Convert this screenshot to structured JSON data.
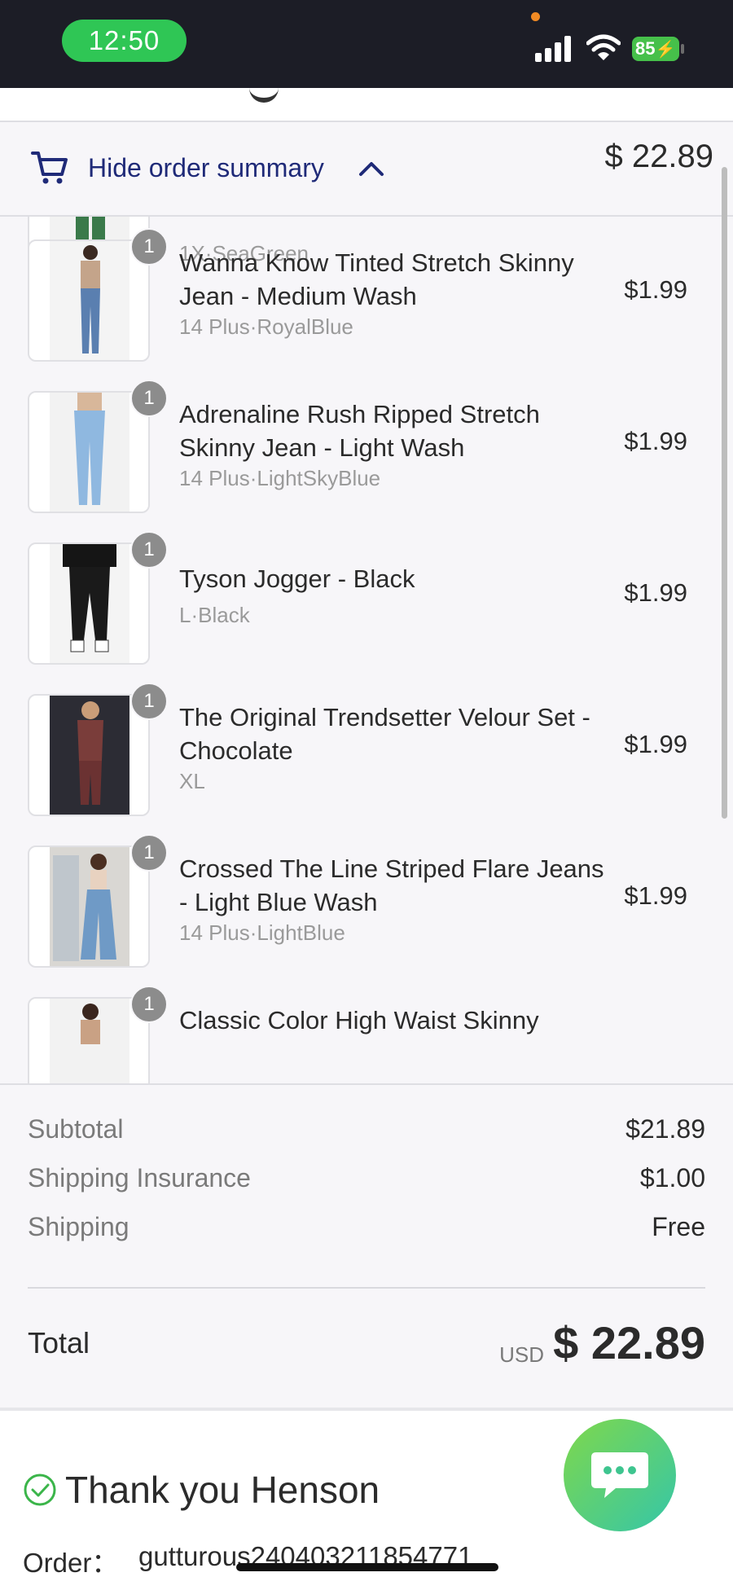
{
  "status_bar": {
    "time": "12:50",
    "battery": "85"
  },
  "summary": {
    "toggle_label": "Hide order summary",
    "header_total": "$ 22.89"
  },
  "items": [
    {
      "name": "",
      "variant": "1X·SeaGreen",
      "price": "",
      "qty": ""
    },
    {
      "name": "Wanna Know Tinted Stretch Skinny Jean - Medium Wash",
      "variant": "14 Plus·RoyalBlue",
      "price": "$1.99",
      "qty": "1"
    },
    {
      "name": "Adrenaline Rush Ripped Stretch Skinny Jean - Light Wash",
      "variant": "14 Plus·LightSkyBlue",
      "price": "$1.99",
      "qty": "1"
    },
    {
      "name": "Tyson Jogger - Black",
      "variant": "L·Black",
      "price": "$1.99",
      "qty": "1"
    },
    {
      "name": "The Original Trendsetter Velour Set - Chocolate",
      "variant": "XL",
      "price": "$1.99",
      "qty": "1"
    },
    {
      "name": "Crossed The Line Striped Flare Jeans - Light Blue Wash",
      "variant": "14 Plus·LightBlue",
      "price": "$1.99",
      "qty": "1"
    },
    {
      "name": "Classic Color High Waist Skinny",
      "variant": "",
      "price": "",
      "qty": "1"
    }
  ],
  "totals": {
    "subtotal_label": "Subtotal",
    "subtotal_value": "$21.89",
    "insurance_label": "Shipping Insurance",
    "insurance_value": "$1.00",
    "shipping_label": "Shipping",
    "shipping_value": "Free",
    "total_label": "Total",
    "currency": "USD",
    "total_value": "$ 22.89"
  },
  "confirmation": {
    "thank_you": "Thank you Henson",
    "order_label": "Order：",
    "order_number": "gutturous240403211854771"
  },
  "colors": {
    "accent": "#1f2a78",
    "status_green": "#2fc655",
    "chat_gradient_start": "#7fd84b",
    "chat_gradient_end": "#35c6a8"
  }
}
